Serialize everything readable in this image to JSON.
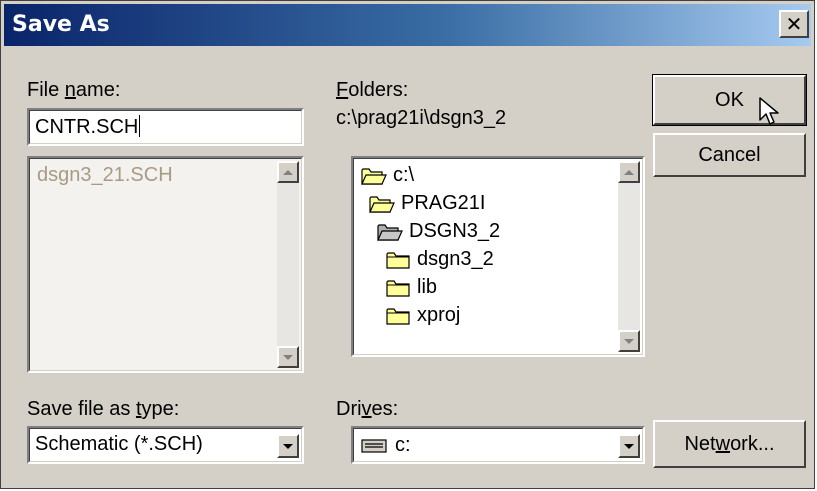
{
  "dialog": {
    "title": "Save As",
    "close_label": "✕"
  },
  "file_name": {
    "label_pre": "File ",
    "label_ul": "n",
    "label_post": "ame:",
    "value": "CNTR.SCH",
    "files": [
      "dsgn3_21.SCH"
    ]
  },
  "folders": {
    "label_ul": "F",
    "label_post": "olders:",
    "current_path": "c:\\prag21i\\dsgn3_2",
    "tree": [
      {
        "name": "c:\\",
        "state": "open"
      },
      {
        "name": "PRAG21I",
        "state": "open"
      },
      {
        "name": "DSGN3_2",
        "state": "open-selected"
      },
      {
        "name": "dsgn3_2",
        "state": "closed"
      },
      {
        "name": "lib",
        "state": "closed"
      },
      {
        "name": "xproj",
        "state": "closed"
      }
    ]
  },
  "file_type": {
    "label_pre": "Save file as ",
    "label_ul": "t",
    "label_post": "ype:",
    "value": "Schematic (*.SCH)"
  },
  "drives": {
    "label_pre": "Dri",
    "label_ul": "v",
    "label_post": "es:",
    "value": "c:"
  },
  "buttons": {
    "ok": "OK",
    "cancel": "Cancel",
    "network_pre": "Net",
    "network_ul": "w",
    "network_post": "ork..."
  },
  "icons": {
    "close": "close-icon",
    "folder_open": "folder-open-icon",
    "folder_closed": "folder-closed-icon",
    "drive": "drive-icon",
    "cursor": "mouse-pointer-icon"
  },
  "colors": {
    "title_start": "#0a246a",
    "title_end": "#a6caf0",
    "face": "#d4d0c8",
    "folder": "#ffff99",
    "disabled_text": "#a89a85"
  }
}
